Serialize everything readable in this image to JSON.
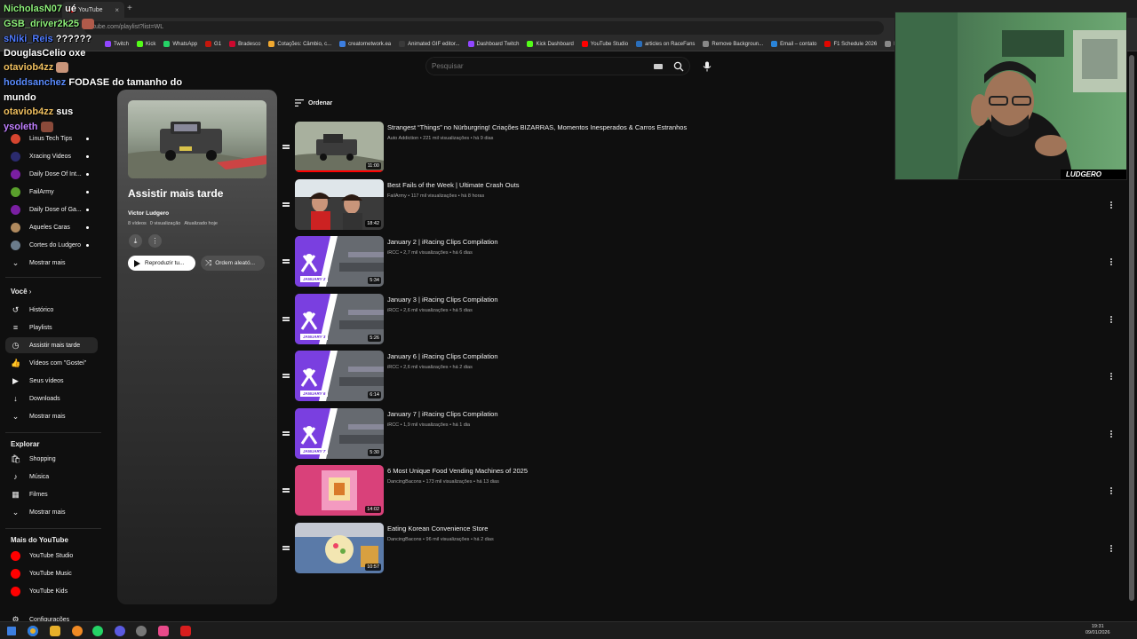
{
  "browser": {
    "tab_title": "YouTube",
    "url": "tube.com/playlist?list=WL",
    "bookmarks": [
      {
        "label": "Twitch",
        "color": "#9146ff"
      },
      {
        "label": "Kick",
        "color": "#53fc18"
      },
      {
        "label": "WhatsApp",
        "color": "#25d366"
      },
      {
        "label": "G1",
        "color": "#c4170c"
      },
      {
        "label": "Bradesco",
        "color": "#cc092f"
      },
      {
        "label": "Cotações: Câmbio, c...",
        "color": "#f0a830"
      },
      {
        "label": "creatornetwork.ea",
        "color": "#3c7ee0"
      },
      {
        "label": "Animated GIF editor...",
        "color": "#3a3a3a"
      },
      {
        "label": "Dashboard Twitch",
        "color": "#9146ff"
      },
      {
        "label": "Kick Dashboard",
        "color": "#53fc18"
      },
      {
        "label": "YouTube Studio",
        "color": "#ff0000"
      },
      {
        "label": "articles on RaceFans",
        "color": "#2a6ebb"
      },
      {
        "label": "Remove Backgroun...",
        "color": "#888888"
      },
      {
        "label": "Email – contato",
        "color": "#2a84d8"
      },
      {
        "label": "F1 Schedule 2026",
        "color": "#e10600"
      },
      {
        "label": "NFS",
        "color": "#888888"
      }
    ]
  },
  "search": {
    "placeholder": "Pesquisar"
  },
  "sidebar": {
    "subscriptions": [
      {
        "label": "Linus Tech Tips",
        "color": "#d6452f"
      },
      {
        "label": "Xracing Videos",
        "color": "#2b2b6e"
      },
      {
        "label": "Daily Dose Of Int...",
        "color": "#7a1fa2"
      },
      {
        "label": "FailArmy",
        "color": "#5aa02c"
      },
      {
        "label": "Daily Dose of Ga...",
        "color": "#7a1fa2"
      },
      {
        "label": "Aqueles Caras",
        "color": "#b08a5e"
      },
      {
        "label": "Cortes do Ludgero",
        "color": "#6b7c8c"
      }
    ],
    "show_more": "Mostrar mais",
    "you_header": "Você",
    "you_items": [
      {
        "label": "Histórico",
        "icon": "history-icon",
        "glyph": "↺"
      },
      {
        "label": "Playlists",
        "icon": "playlists-icon",
        "glyph": "≡"
      },
      {
        "label": "Assistir mais tarde",
        "icon": "watch-later-icon",
        "glyph": "◷"
      },
      {
        "label": "Vídeos com \"Gostei\"",
        "icon": "like-icon",
        "glyph": "👍"
      },
      {
        "label": "Seus vídeos",
        "icon": "your-videos-icon",
        "glyph": "▶"
      },
      {
        "label": "Downloads",
        "icon": "download-icon",
        "glyph": "↓"
      },
      {
        "label": "Mostrar mais",
        "icon": "chevron-down-icon",
        "glyph": "⌄"
      }
    ],
    "explore_header": "Explorar",
    "explore_items": [
      {
        "label": "Shopping",
        "icon": "shopping-icon",
        "glyph": "🛍"
      },
      {
        "label": "Música",
        "icon": "music-icon",
        "glyph": "♪"
      },
      {
        "label": "Filmes",
        "icon": "movies-icon",
        "glyph": "▦"
      },
      {
        "label": "Mostrar mais",
        "icon": "chevron-down-icon",
        "glyph": "⌄"
      }
    ],
    "more_header": "Mais do YouTube",
    "more_items": [
      {
        "label": "YouTube Studio",
        "color": "#ff0000"
      },
      {
        "label": "YouTube Music",
        "color": "#ff0000"
      },
      {
        "label": "YouTube Kids",
        "color": "#ff0000"
      }
    ],
    "settings": "Configurações"
  },
  "playlist": {
    "title": "Assistir mais tarde",
    "owner": "Victor Ludgero",
    "videos": "8 vídeos",
    "views": "0 visualização",
    "updated": "Atualizado hoje",
    "play_label": "Reproduzir tu...",
    "shuffle_label": "Ordem aleató..."
  },
  "sort_label": "Ordenar",
  "videos": [
    {
      "title": "Strangest “Things” no Nürburgring! Criações BIZARRAS, Momentos Inesperados & Carros Estranhos",
      "channel": "Auto Addiction",
      "views": "221 mil visualizações",
      "age": "há 9 dias",
      "duration": "11:00",
      "thumb": "car",
      "progress": 1.0
    },
    {
      "title": "Best Fails of the Week | Ultimate Crash Outs",
      "channel": "FailArmy",
      "views": "117 mil visualizações",
      "age": "há 8 horas",
      "duration": "18:42",
      "thumb": "fails",
      "progress": 0
    },
    {
      "title": "January 2 | iRacing Clips Compilation",
      "channel": "iRCC",
      "views": "2,7 mil visualizações",
      "age": "há 6 dias",
      "duration": "5:34",
      "thumb": "iracing",
      "label": "JANUARY 2",
      "progress": 0
    },
    {
      "title": "January 3 | iRacing Clips Compilation",
      "channel": "iRCC",
      "views": "2,6 mil visualizações",
      "age": "há 5 dias",
      "duration": "5:26",
      "thumb": "iracing",
      "label": "JANUARY 3",
      "progress": 0
    },
    {
      "title": "January 6 | iRacing Clips Compilation",
      "channel": "iRCC",
      "views": "2,6 mil visualizações",
      "age": "há 2 dias",
      "duration": "6:14",
      "thumb": "iracing",
      "label": "JANUARY 6",
      "progress": 0
    },
    {
      "title": "January 7 | iRacing Clips Compilation",
      "channel": "iRCC",
      "views": "1,9 mil visualizações",
      "age": "há 1 dia",
      "duration": "5:30",
      "thumb": "iracing",
      "label": "JANUARY 7",
      "progress": 0
    },
    {
      "title": "6 Most Unique Food Vending Machines of 2025",
      "channel": "DancingBacons",
      "views": "173 mil visualizações",
      "age": "há 13 dias",
      "duration": "14:02",
      "thumb": "vending",
      "progress": 0
    },
    {
      "title": "Eating Korean Convenience Store",
      "channel": "DancingBacons",
      "views": "96 mil visualizações",
      "age": "há 2 dias",
      "duration": "10:57",
      "thumb": "korean",
      "progress": 0
    }
  ],
  "chat": [
    {
      "user": "NicholasN07",
      "color": "#8ef07a",
      "text": "ué"
    },
    {
      "user": "GSB_driver2k25",
      "color": "#8ef07a",
      "text": ""
    },
    {
      "user": "sNiki_Reis",
      "color": "#4f7bff",
      "text": "??????"
    },
    {
      "user": "DouglasCelio",
      "color": "#ffffff",
      "text": "oxe"
    },
    {
      "user": "otaviob4zz",
      "color": "#f0c060",
      "text": ""
    },
    {
      "user": "hoddsanchez",
      "color": "#5a8cff",
      "text": "FODASE do tamanho do"
    },
    {
      "user": "",
      "color": "#ffffff",
      "text": "mundo"
    },
    {
      "user": "otaviob4zz",
      "color": "#f0c060",
      "text": "sus"
    },
    {
      "user": "ysoleth",
      "color": "#c080ff",
      "text": ""
    }
  ],
  "webcam": {
    "tag": "LUDGERO"
  },
  "clock": {
    "time": "19:31",
    "date": "09/01/2026"
  }
}
